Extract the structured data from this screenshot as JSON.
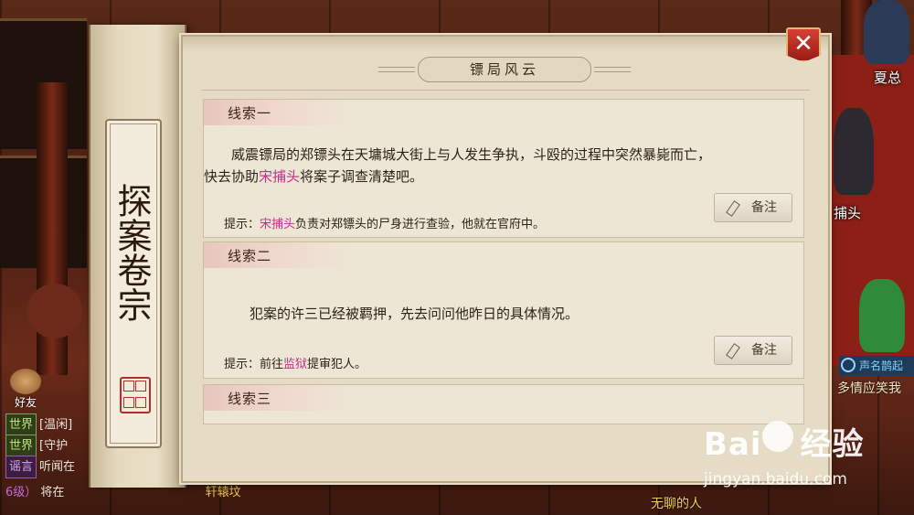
{
  "panel": {
    "title": "镖局风云",
    "spine_title": "探案卷宗",
    "close_symbol": "✕"
  },
  "clues": [
    {
      "title": "线索一",
      "body_before": "威震镖局的郑镖头在天墉城大街上与人发生争执，斗殴的过程中突然暴毙而亡，",
      "body_line2_a": "快去协助",
      "body_line2_hl": "宋捕头",
      "body_line2_b": "将案子调查清楚吧。",
      "hint_prefix": "提示：",
      "hint_hl": "宋捕头",
      "hint_rest": "负责对郑镖头的尸身进行查验，他就在官府中。",
      "note_label": "备注"
    },
    {
      "title": "线索二",
      "body": "犯案的许三已经被羁押，先去问问他昨日的具体情况。",
      "hint_prefix": "提示：前往",
      "hint_hl": "监狱",
      "hint_rest": "提审犯人。",
      "note_label": "备注"
    },
    {
      "title": "线索三"
    }
  ],
  "background": {
    "npc_name_top": "夏总",
    "npc_name_mid": "捕头",
    "quest_tag": "声名鹊起",
    "side_text": "多情应笑我",
    "bottom_text": "无聊的人",
    "friend_label": "好友"
  },
  "chat": {
    "lines": [
      {
        "channel": "世界",
        "text": "[温闲]"
      },
      {
        "channel": "世界",
        "text": "[守护"
      },
      {
        "channel": "谣言",
        "text": "听闻在"
      }
    ],
    "last_level": "6级）",
    "last_text": "将在",
    "last_place": "轩辕坟"
  },
  "watermark": {
    "logo": "Bai",
    "logo_cn": "经验",
    "url": "jingyan.baidu.com"
  },
  "colors": {
    "highlight": "#c0308a",
    "panel_bg": "#e6dcc6",
    "close_red": "#c2281e"
  }
}
